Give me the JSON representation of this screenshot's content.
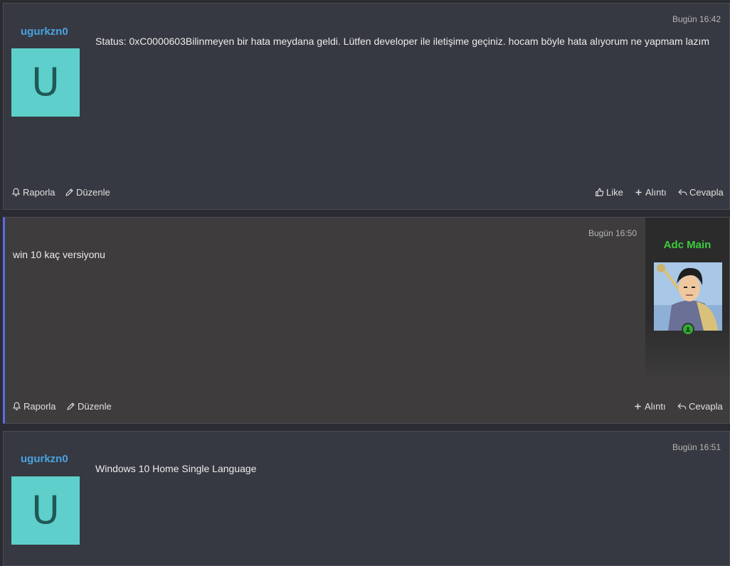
{
  "posts": [
    {
      "username": "ugurkzn0",
      "avatar_letter": "U",
      "time": "Bugün 16:42",
      "message": "Status: 0xC0000603Bilinmeyen bir hata meydana geldi. Lütfen developer ile iletişime geçiniz. hocam böyle hata alıyorum ne yapmam lazım",
      "actions": {
        "report": "Raporla",
        "edit": "Düzenle",
        "like": "Like",
        "quote": "Alıntı",
        "reply": "Cevapla"
      }
    },
    {
      "username": "Adc Main",
      "time": "Bugün 16:50",
      "message": "win 10 kaç versiyonu",
      "actions": {
        "report": "Raporla",
        "edit": "Düzenle",
        "quote": "Alıntı",
        "reply": "Cevapla"
      }
    },
    {
      "username": "ugurkzn0",
      "avatar_letter": "U",
      "time": "Bugün 16:51",
      "message": "Windows 10 Home Single Language"
    }
  ],
  "colors": {
    "username_blue": "#4aa3e0",
    "username_green": "#3dcd3d",
    "avatar_bg": "#5ecfcb",
    "accent_border": "#5c6ce6"
  }
}
